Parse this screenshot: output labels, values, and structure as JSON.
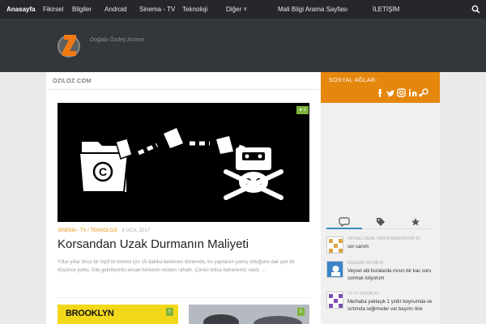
{
  "topnav": {
    "items": [
      "Anasayfa",
      "Fikirsel",
      "Bilgiler",
      "Android",
      "Sinema - TV",
      "Teknoloji",
      "Diğer",
      "Mali Bilgi Arama Sayfası",
      "İLETİŞİM"
    ],
    "dropdown_marker": "˅",
    "search_icon": "search-icon"
  },
  "header": {
    "tagline": "Doğala Özdeş Aroma"
  },
  "page": {
    "breadcrumb": "OZILOZ.COM"
  },
  "post": {
    "comment_count": "0",
    "categories": "SİNEMA - TV / TEKNOLOJİ",
    "date": "6 OCA, 2017",
    "title": "Korsandan Uzak Durmanın Maliyeti",
    "excerpt": "Yıllar yıllar önce bir mp3'ün inmesi için 15 dakika beklenen dönemde, bu yapılanın yanlış olduğuna dair pek bir düşünce yoktu. Dile getiriliyordu ancak herkesin vicdanı rahattı. Çünkü bolca bahanemiz vardı. ..."
  },
  "related": [
    {
      "thumb_text": "BROOKLYN",
      "comment_count": "0"
    },
    {
      "comment_count": "0"
    }
  ],
  "sidebar": {
    "social_title": "SOSYAL AĞLAR:",
    "social_icons": [
      "facebook-icon",
      "twitter-icon",
      "instagram-icon",
      "linkedin-icon",
      "steam-icon"
    ],
    "tabs": [
      "comments-icon",
      "tags-icon",
      "star-icon"
    ],
    "comments": [
      {
        "author": "VEYSEL DERE DİRON MANI DİYOR Kİ:",
        "text": "sor canım"
      },
      {
        "author": "RÜZGAR DİYOR Kİ:",
        "text": "Veysel abi buralarda mısın bir kac soru sormak istiyorum"
      },
      {
        "author": "YY YY DİYOR Kİ:",
        "text": "Merhaba yaklaşık 1 yıldır boynumda ve sırtımda seğirmeler var başımı öne"
      }
    ]
  },
  "colors": {
    "accent": "#e4870c",
    "comment_badge": "#7db33b",
    "topbar": "#26272b",
    "header": "#33363b"
  }
}
